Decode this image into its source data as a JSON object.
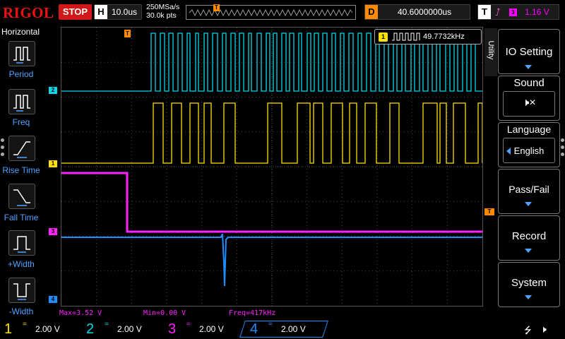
{
  "brand": {
    "logo": "RIGOL"
  },
  "status": {
    "run_state": "STOP"
  },
  "horizontal": {
    "label": "H",
    "timebase": "10.0us"
  },
  "acquisition": {
    "sample_rate": "250MSa/s",
    "memory_depth": "30.0k pts"
  },
  "delay": {
    "label": "D",
    "value": "40.6000000us"
  },
  "trigger": {
    "label": "T",
    "slope_icon": "rising-edge-icon",
    "source": "3",
    "level": "1.16 V",
    "marker": "T"
  },
  "left_menu": {
    "title": "Horizontal",
    "items": [
      {
        "label": "Period",
        "icon": "period-icon"
      },
      {
        "label": "Freq",
        "icon": "freq-icon"
      },
      {
        "label": "Rise Time",
        "icon": "rise-time-icon"
      },
      {
        "label": "Fall Time",
        "icon": "fall-time-icon"
      },
      {
        "label": "+Width",
        "icon": "positive-width-icon"
      },
      {
        "label": "-Width",
        "icon": "negative-width-icon"
      }
    ]
  },
  "measurement": {
    "channel": "1",
    "value": "49.7732kHz"
  },
  "readouts": {
    "max": "Max=3.52 V",
    "min": "Min=0.00 V",
    "freq": "Freq=417kHz"
  },
  "channels": [
    {
      "num": "1",
      "coupling": "=",
      "scale": "2.00 V",
      "color": "#ffe100"
    },
    {
      "num": "2",
      "coupling": "=",
      "scale": "2.00 V",
      "color": "#00d7e8"
    },
    {
      "num": "3",
      "coupling": "=",
      "scale": "2.00 V",
      "color": "#ff22ff"
    },
    {
      "num": "4",
      "coupling": "=",
      "scale": "2.00 V",
      "color": "#1f8cff"
    }
  ],
  "right_menu": {
    "tab": "Utility",
    "items": [
      {
        "label": "IO Setting"
      },
      {
        "label": "Sound",
        "sub_icon": "speaker-muted-icon"
      },
      {
        "label": "Language",
        "sub_value": "English"
      },
      {
        "label": "Pass/Fail"
      },
      {
        "label": "Record"
      },
      {
        "label": "System"
      }
    ]
  },
  "status_icons": [
    "usb-icon",
    "speaker-muted-icon"
  ]
}
